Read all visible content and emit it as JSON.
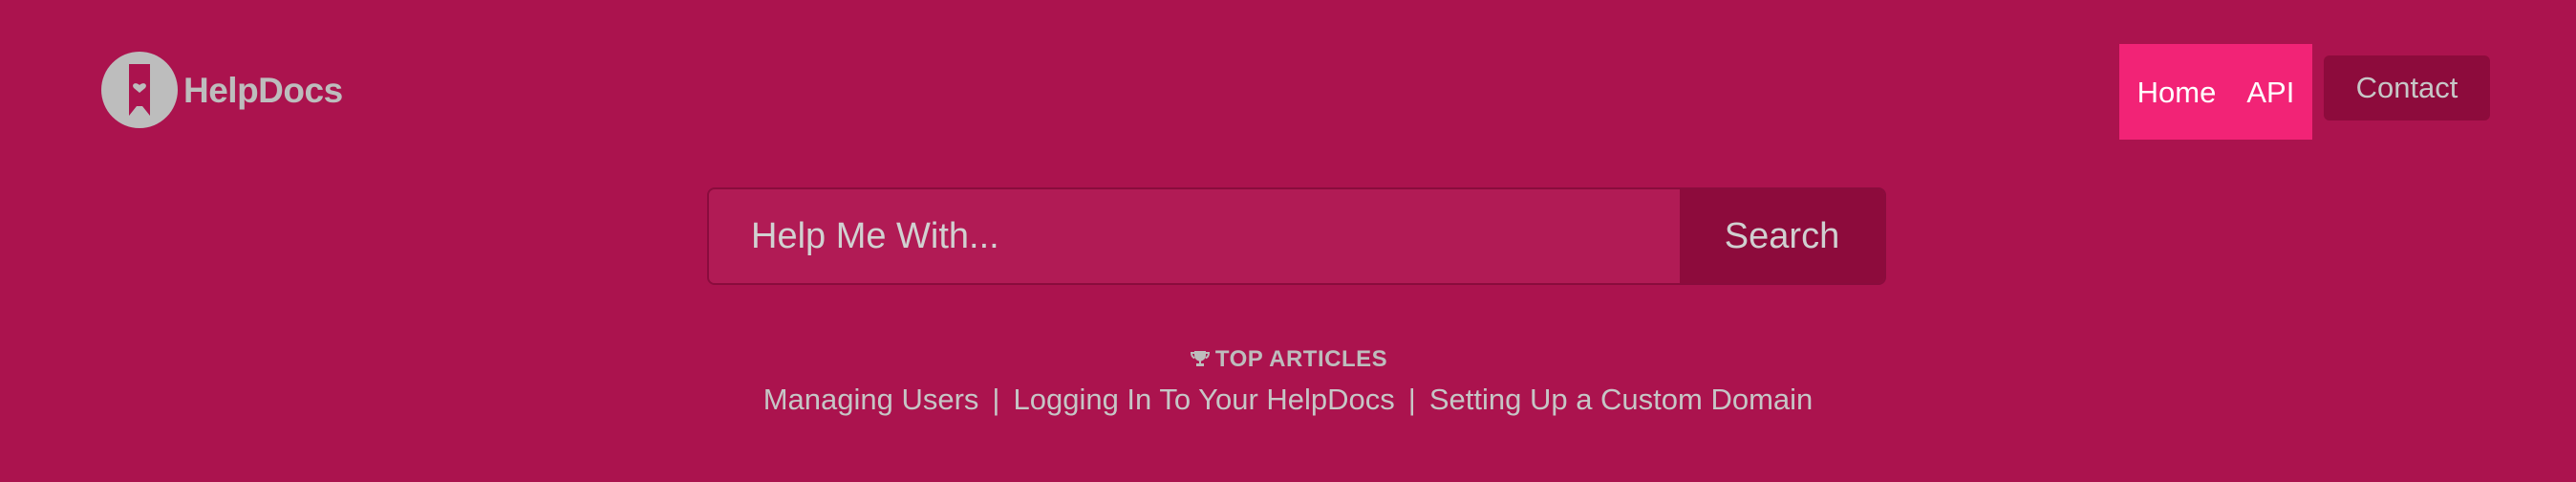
{
  "brand": {
    "name": "HelpDocs"
  },
  "nav": {
    "home": "Home",
    "api": "API",
    "contact": "Contact"
  },
  "search": {
    "placeholder": "Help Me With...",
    "button_label": "Search"
  },
  "top_articles": {
    "heading": "TOP ARTICLES",
    "items": [
      "Managing Users",
      "Logging In To Your HelpDocs",
      "Setting Up a Custom Domain"
    ]
  },
  "colors": {
    "background": "#ab134e",
    "nav_active": "#f22376",
    "button_dark": "#8d0b3c",
    "text_gray": "#bdbdbd"
  },
  "icons": {
    "logo": "helpdocs-logo-icon",
    "trophy": "trophy-icon"
  }
}
